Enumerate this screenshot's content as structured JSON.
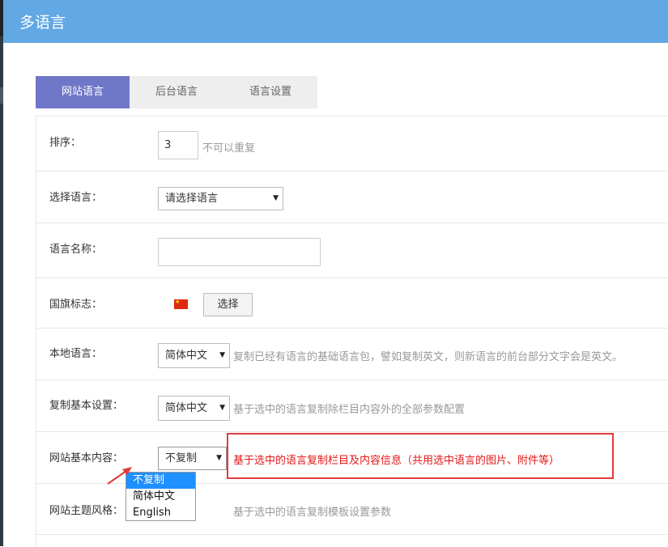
{
  "header": {
    "title": "多语言"
  },
  "tabs": [
    {
      "label": "网站语言",
      "active": true
    },
    {
      "label": "后台语言",
      "active": false
    },
    {
      "label": "语言设置",
      "active": false
    }
  ],
  "form": {
    "sort": {
      "label": "排序：",
      "value": "3",
      "hint": "不可以重复"
    },
    "select_language": {
      "label": "选择语言：",
      "value": "请选择语言"
    },
    "language_name": {
      "label": "语言名称：",
      "value": ""
    },
    "flag": {
      "label": "国旗标志：",
      "button": "选择",
      "icon": "china-flag-icon"
    },
    "local_language": {
      "label": "本地语言：",
      "value": "简体中文",
      "hint": "复制已经有语言的基础语言包，譬如复制英文，则新语言的前台部分文字会是英文。"
    },
    "copy_basic": {
      "label": "复制基本设置：",
      "value": "简体中文",
      "hint": "基于选中的语言复制除栏目内容外的全部参数配置"
    },
    "site_content": {
      "label": "网站基本内容：",
      "value": "不复制",
      "hint": "基于选中的语言复制栏目及内容信息（共用选中语言的图片、附件等）",
      "options": [
        "不复制",
        "简体中文",
        "English"
      ]
    },
    "site_theme": {
      "label": "网站主题风格：",
      "hint": "基于选中的语言复制模板设置参数"
    }
  },
  "colors": {
    "header": "#62a8e5",
    "active_tab": "#6f77c8",
    "highlight": "#e23a3a",
    "option_selected": "#1e90ff"
  }
}
